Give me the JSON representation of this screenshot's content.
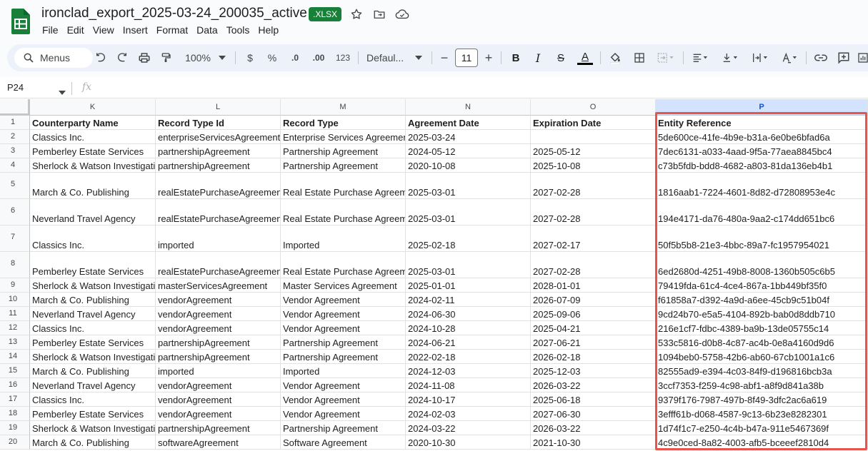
{
  "document": {
    "title": "ironclad_export_2025-03-24_200035_active",
    "badge": ".XLSX"
  },
  "menu": [
    "File",
    "Edit",
    "View",
    "Insert",
    "Format",
    "Data",
    "Tools",
    "Help"
  ],
  "toolbar": {
    "search_label": "Menus",
    "zoom": "100%",
    "currency": "$",
    "percent": "%",
    "decrease_decimal": ".0",
    "increase_decimal": ".00",
    "number_format": "123",
    "font": "Defaul...",
    "font_size": "11",
    "minus": "−",
    "plus": "+",
    "bold": "B",
    "italic": "I",
    "strike": "S",
    "text_color_letter": "A",
    "text_color": "#000000"
  },
  "formula_bar": {
    "cell_ref": "P24",
    "fx": "fx"
  },
  "grid": {
    "columns": [
      "K",
      "L",
      "M",
      "N",
      "O",
      "P"
    ],
    "selected_column": "P",
    "rows": [
      {
        "num": "1",
        "cells": [
          "Counterparty Name",
          "Record Type Id",
          "Record Type",
          "Agreement Date",
          "Expiration Date",
          "Entity Reference"
        ]
      },
      {
        "num": "2",
        "cells": [
          "Classics Inc.",
          "enterpriseServicesAgreement",
          "Enterprise Services Agreement",
          "2025-03-24",
          "",
          "5de600ce-41fe-4b9e-b31a-6e0be6bfad6a"
        ]
      },
      {
        "num": "3",
        "cells": [
          "Pemberley Estate Services",
          "partnershipAgreement",
          "Partnership Agreement",
          "2024-05-12",
          "2025-05-12",
          "7dec6131-a033-4aad-9f5a-77aea8845bc4"
        ]
      },
      {
        "num": "4",
        "cells": [
          "Sherlock & Watson Investigations",
          "partnershipAgreement",
          "Partnership Agreement",
          "2020-10-08",
          "2025-10-08",
          "c73b5fdb-bdd8-4682-a803-81da136eb4b1"
        ]
      },
      {
        "num": "5",
        "cells": [
          "March & Co. Publishing",
          "realEstatePurchaseAgreement",
          "Real Estate Purchase Agreement",
          "2025-03-01",
          "2027-02-28",
          "1816aab1-7224-4601-8d82-d72808953e4c"
        ]
      },
      {
        "num": "6",
        "cells": [
          "Neverland Travel Agency",
          "realEstatePurchaseAgreement",
          "Real Estate Purchase Agreement",
          "2025-03-01",
          "2027-02-28",
          "194e4171-da76-480a-9aa2-c174dd651bc6"
        ]
      },
      {
        "num": "7",
        "cells": [
          "Classics Inc.",
          "imported",
          "Imported",
          "2025-02-18",
          "2027-02-17",
          "50f5b5b8-21e3-4bbc-89a7-fc1957954021"
        ]
      },
      {
        "num": "8",
        "cells": [
          "Pemberley Estate Services",
          "realEstatePurchaseAgreement",
          "Real Estate Purchase Agreement",
          "2025-03-01",
          "2027-02-28",
          "6ed2680d-4251-49b8-8008-1360b505c6b5"
        ]
      },
      {
        "num": "9",
        "cells": [
          "Sherlock & Watson Investigations",
          "masterServicesAgreement",
          "Master Services Agreement",
          "2025-01-01",
          "2028-01-01",
          "79419fda-61c4-4ce4-867a-1bb449bf35f0"
        ]
      },
      {
        "num": "10",
        "cells": [
          "March & Co. Publishing",
          "vendorAgreement",
          "Vendor Agreement",
          "2024-02-11",
          "2026-07-09",
          "f61858a7-d392-4a9d-a6ee-45cb9c51b04f"
        ]
      },
      {
        "num": "11",
        "cells": [
          "Neverland Travel Agency",
          "vendorAgreement",
          "Vendor Agreement",
          "2024-06-30",
          "2025-09-06",
          "9cd24b70-e5a5-4104-892b-bab0d8ddb710"
        ]
      },
      {
        "num": "12",
        "cells": [
          "Classics Inc.",
          "vendorAgreement",
          "Vendor Agreement",
          "2024-10-28",
          "2025-04-21",
          "216e1cf7-fdbc-4389-ba9b-13de05755c14"
        ]
      },
      {
        "num": "13",
        "cells": [
          "Pemberley Estate Services",
          "partnershipAgreement",
          "Partnership Agreement",
          "2024-06-21",
          "2027-06-21",
          "533c5816-d0b8-4c87-ac4b-0e8a4160d9d6"
        ]
      },
      {
        "num": "14",
        "cells": [
          "Sherlock & Watson Investigations",
          "partnershipAgreement",
          "Partnership Agreement",
          "2022-02-18",
          "2026-02-18",
          "1094beb0-5758-42b6-ab60-67cb1001a1c6"
        ]
      },
      {
        "num": "15",
        "cells": [
          "March & Co. Publishing",
          "imported",
          "Imported",
          "2024-12-03",
          "2025-12-03",
          "82555ad9-e394-4c03-84f9-d196816bcb3a"
        ]
      },
      {
        "num": "16",
        "cells": [
          "Neverland Travel Agency",
          "vendorAgreement",
          "Vendor Agreement",
          "2024-11-08",
          "2026-03-22",
          "3ccf7353-f259-4c98-abf1-a8f9d841a38b"
        ]
      },
      {
        "num": "17",
        "cells": [
          "Classics Inc.",
          "vendorAgreement",
          "Vendor Agreement",
          "2024-10-17",
          "2025-06-18",
          "9379f176-7987-497b-8f49-3dfc2ac6a619"
        ]
      },
      {
        "num": "18",
        "cells": [
          "Pemberley Estate Services",
          "vendorAgreement",
          "Vendor Agreement",
          "2024-02-03",
          "2027-06-30",
          "3efff61b-d068-4587-9c13-6b23e8282301"
        ]
      },
      {
        "num": "19",
        "cells": [
          "Sherlock & Watson Investigations",
          "partnershipAgreement",
          "Partnership Agreement",
          "2024-03-22",
          "2026-03-22",
          "1d74f1c7-e250-4c4b-b47a-911e5467369f"
        ]
      },
      {
        "num": "20",
        "cells": [
          "March & Co. Publishing",
          "softwareAgreement",
          "Software Agreement",
          "2020-10-30",
          "2021-10-30",
          "4c9e0ced-8a82-4003-afb5-bceeef2810d4"
        ]
      }
    ]
  },
  "colors": {
    "sheets_green": "#188038",
    "highlight_border": "#e8544b",
    "selected_header_bg": "#d3e3fd"
  }
}
